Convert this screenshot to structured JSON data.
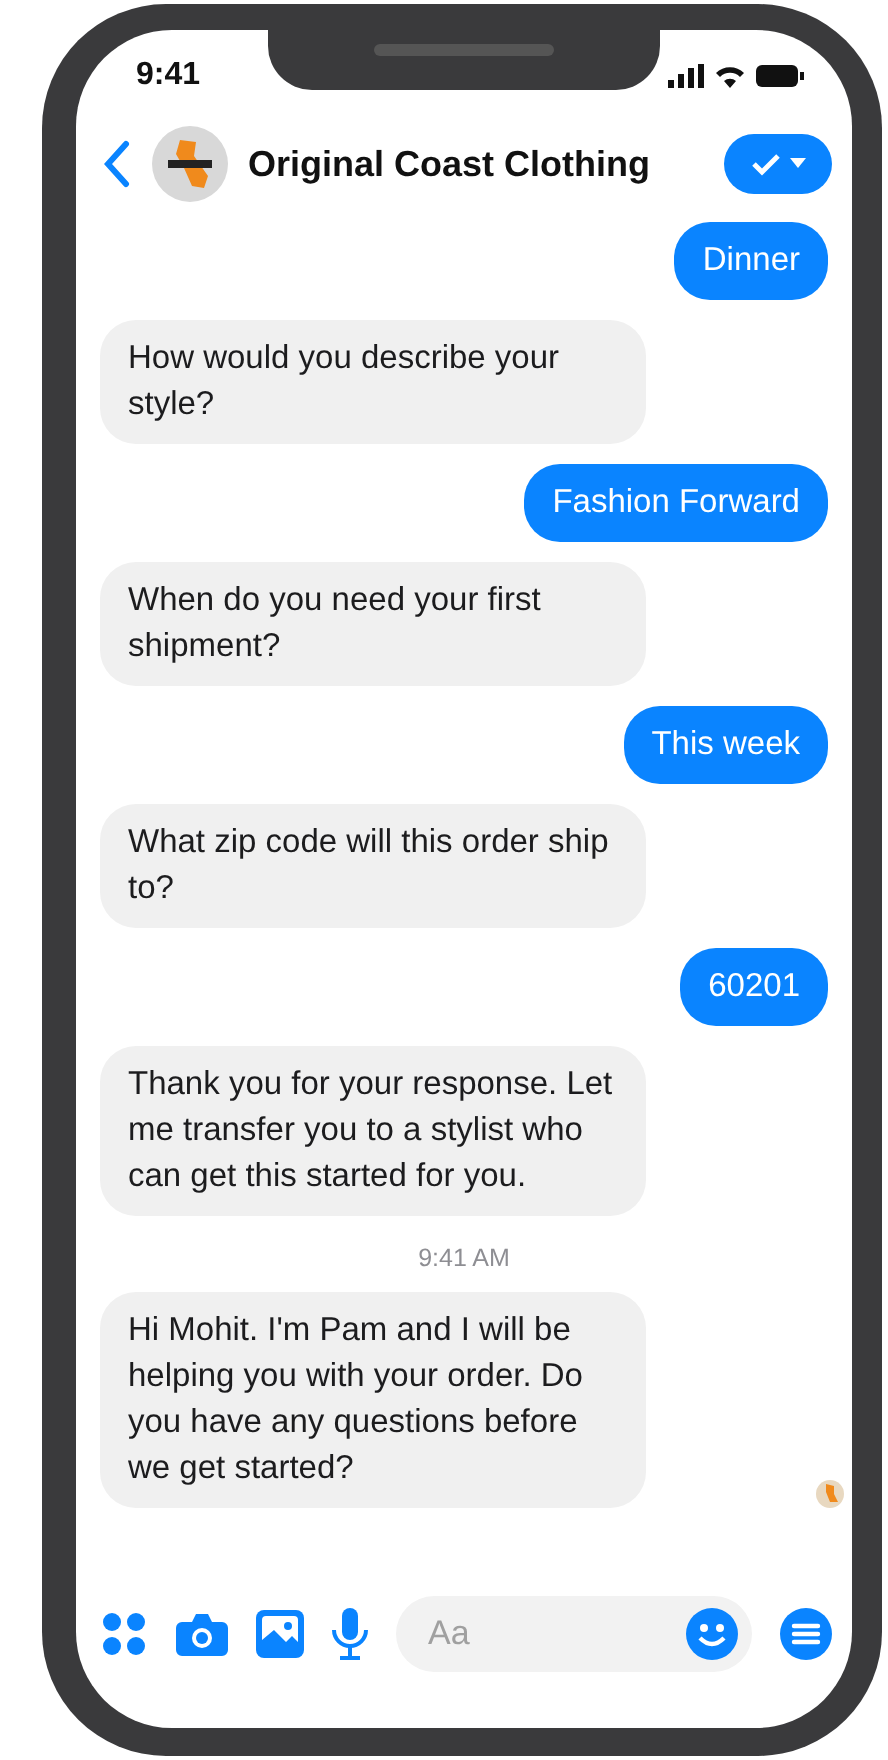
{
  "status_bar": {
    "time": "9:41"
  },
  "header": {
    "title": "Original Coast Clothing"
  },
  "messages": [
    {
      "kind": "outgoing",
      "text": "Dinner"
    },
    {
      "kind": "incoming",
      "text": "How would you describe your style?"
    },
    {
      "kind": "outgoing",
      "text": "Fashion Forward"
    },
    {
      "kind": "incoming",
      "text": "When do you need your first shipment?"
    },
    {
      "kind": "outgoing",
      "text": "This week"
    },
    {
      "kind": "incoming",
      "text": "What zip code will this order ship to?"
    },
    {
      "kind": "outgoing",
      "text": "60201"
    },
    {
      "kind": "incoming",
      "text": "Thank you for your response. Let me transfer you to a stylist who can get this started for you."
    },
    {
      "kind": "time",
      "text": "9:41 AM"
    },
    {
      "kind": "incoming",
      "text": "Hi Mohit. I'm Pam and I will be helping you with your order. Do you have any questions before we get started?"
    }
  ],
  "composer": {
    "placeholder": "Aa"
  }
}
